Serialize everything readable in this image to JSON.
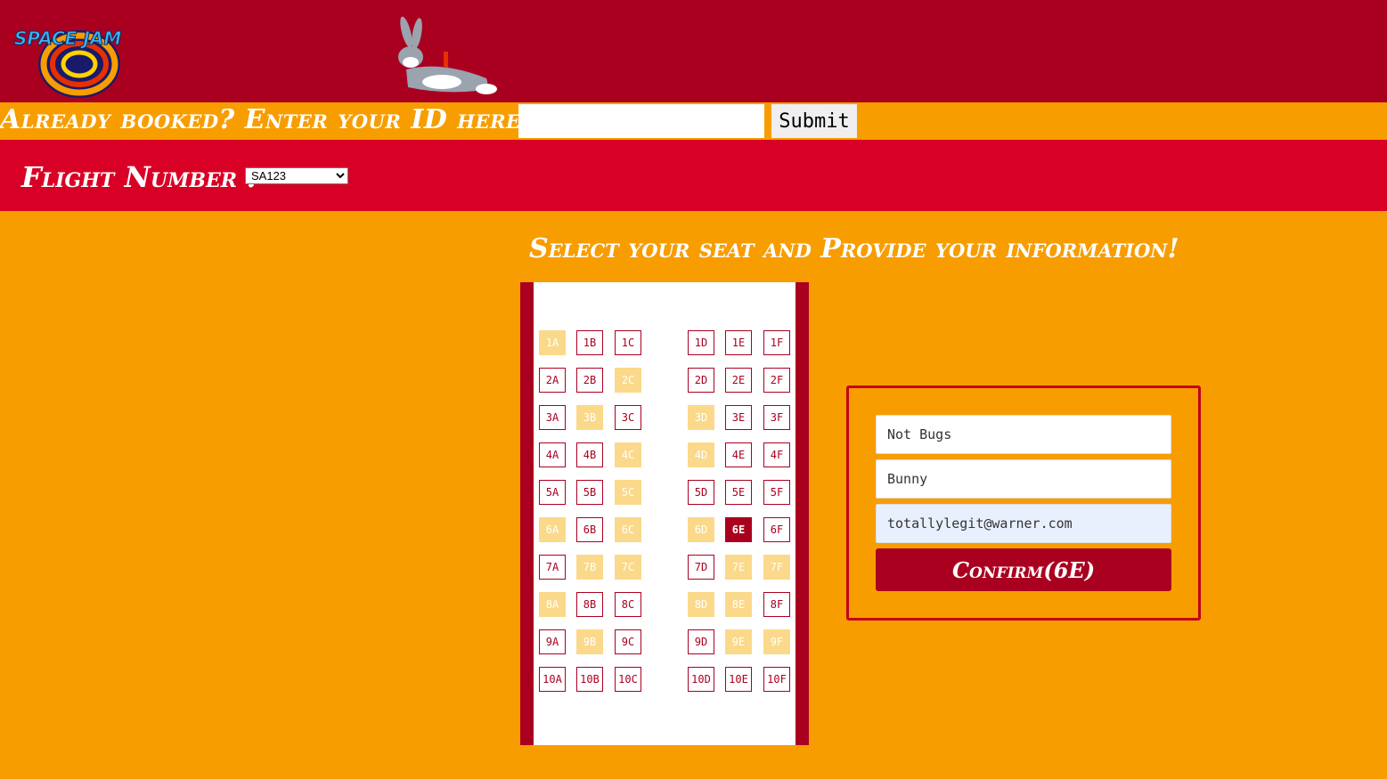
{
  "header": {
    "logo_text": "SPACE JAM",
    "logo_icon": "space-jam-logo",
    "mascot_icon": "bugs-bunny-mascot"
  },
  "booking_lookup": {
    "label": "Already booked? Enter your ID here!",
    "id_value": "",
    "submit_label": "Submit"
  },
  "flight": {
    "label": "Flight Number :",
    "selected": "SA123"
  },
  "section_title": "Select your seat and Provide your information!",
  "seatmap": {
    "rows": [
      {
        "seats": [
          {
            "id": "1A",
            "status": "taken"
          },
          {
            "id": "1B",
            "status": "free"
          },
          {
            "id": "1C",
            "status": "free"
          },
          {
            "id": "1D",
            "status": "free"
          },
          {
            "id": "1E",
            "status": "free"
          },
          {
            "id": "1F",
            "status": "free"
          }
        ]
      },
      {
        "seats": [
          {
            "id": "2A",
            "status": "free"
          },
          {
            "id": "2B",
            "status": "free"
          },
          {
            "id": "2C",
            "status": "taken"
          },
          {
            "id": "2D",
            "status": "free"
          },
          {
            "id": "2E",
            "status": "free"
          },
          {
            "id": "2F",
            "status": "free"
          }
        ]
      },
      {
        "seats": [
          {
            "id": "3A",
            "status": "free"
          },
          {
            "id": "3B",
            "status": "taken"
          },
          {
            "id": "3C",
            "status": "free"
          },
          {
            "id": "3D",
            "status": "taken"
          },
          {
            "id": "3E",
            "status": "free"
          },
          {
            "id": "3F",
            "status": "free"
          }
        ]
      },
      {
        "seats": [
          {
            "id": "4A",
            "status": "free"
          },
          {
            "id": "4B",
            "status": "free"
          },
          {
            "id": "4C",
            "status": "taken"
          },
          {
            "id": "4D",
            "status": "taken"
          },
          {
            "id": "4E",
            "status": "free"
          },
          {
            "id": "4F",
            "status": "free"
          }
        ]
      },
      {
        "seats": [
          {
            "id": "5A",
            "status": "free"
          },
          {
            "id": "5B",
            "status": "free"
          },
          {
            "id": "5C",
            "status": "taken"
          },
          {
            "id": "5D",
            "status": "free"
          },
          {
            "id": "5E",
            "status": "free"
          },
          {
            "id": "5F",
            "status": "free"
          }
        ]
      },
      {
        "seats": [
          {
            "id": "6A",
            "status": "taken"
          },
          {
            "id": "6B",
            "status": "free"
          },
          {
            "id": "6C",
            "status": "taken"
          },
          {
            "id": "6D",
            "status": "taken"
          },
          {
            "id": "6E",
            "status": "selected"
          },
          {
            "id": "6F",
            "status": "free"
          }
        ]
      },
      {
        "seats": [
          {
            "id": "7A",
            "status": "free"
          },
          {
            "id": "7B",
            "status": "taken"
          },
          {
            "id": "7C",
            "status": "taken"
          },
          {
            "id": "7D",
            "status": "free"
          },
          {
            "id": "7E",
            "status": "taken"
          },
          {
            "id": "7F",
            "status": "taken"
          }
        ]
      },
      {
        "seats": [
          {
            "id": "8A",
            "status": "taken"
          },
          {
            "id": "8B",
            "status": "free"
          },
          {
            "id": "8C",
            "status": "free"
          },
          {
            "id": "8D",
            "status": "taken"
          },
          {
            "id": "8E",
            "status": "taken"
          },
          {
            "id": "8F",
            "status": "free"
          }
        ]
      },
      {
        "seats": [
          {
            "id": "9A",
            "status": "free"
          },
          {
            "id": "9B",
            "status": "taken"
          },
          {
            "id": "9C",
            "status": "free"
          },
          {
            "id": "9D",
            "status": "free"
          },
          {
            "id": "9E",
            "status": "taken"
          },
          {
            "id": "9F",
            "status": "taken"
          }
        ]
      },
      {
        "seats": [
          {
            "id": "10A",
            "status": "free"
          },
          {
            "id": "10B",
            "status": "free"
          },
          {
            "id": "10C",
            "status": "free"
          },
          {
            "id": "10D",
            "status": "free"
          },
          {
            "id": "10E",
            "status": "free"
          },
          {
            "id": "10F",
            "status": "free"
          }
        ]
      }
    ]
  },
  "form": {
    "first_name": "Not Bugs",
    "last_name": "Bunny",
    "email": "totallylegit@warner.com",
    "confirm_label": "Confirm(6E)"
  },
  "colors": {
    "header_red": "#aa0020",
    "bar_red": "#d80025",
    "background_orange": "#f89d00",
    "taken_seat": "#fbd98a"
  }
}
